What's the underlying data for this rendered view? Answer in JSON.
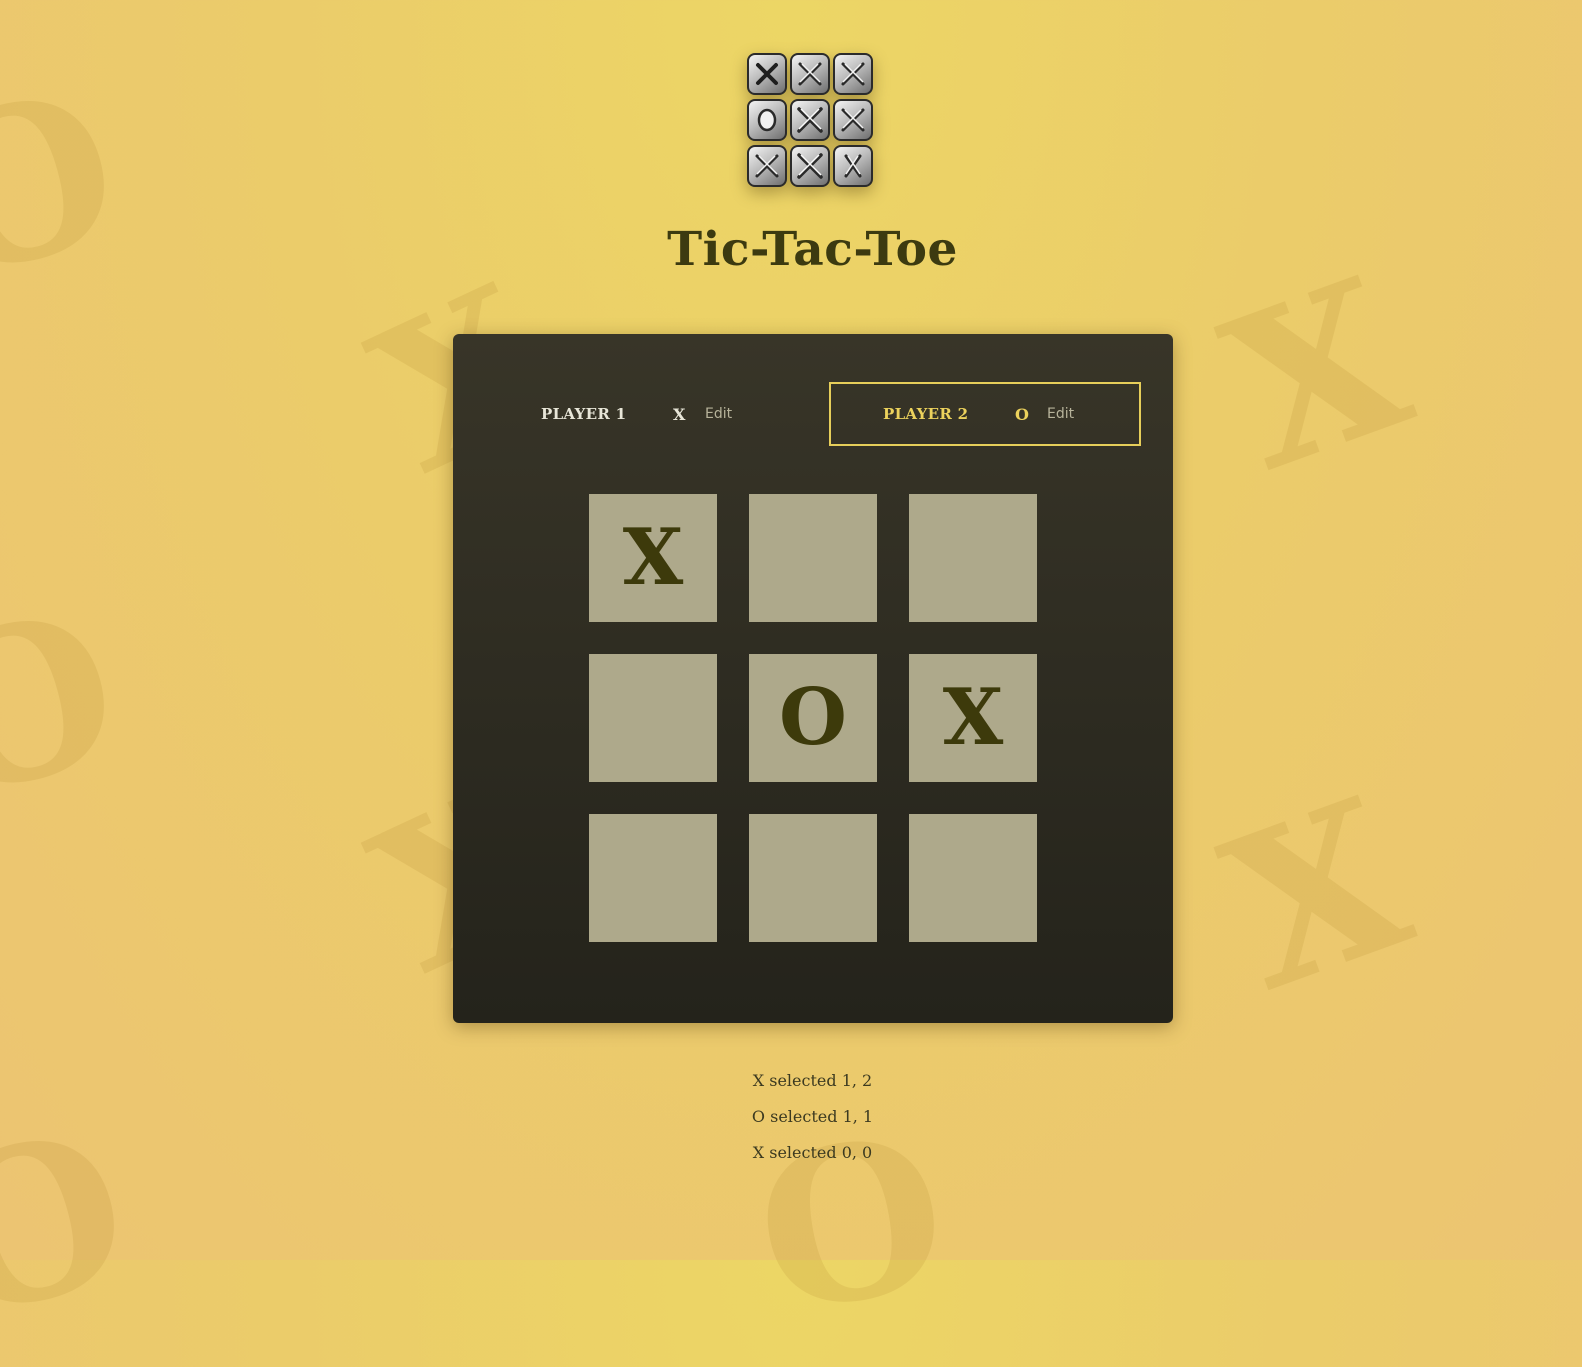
{
  "app": {
    "title": "Tic-Tac-Toe",
    "logo_icon": "tic-tac-toe-logo-icon"
  },
  "background": {
    "glyph_color": "#be963c",
    "glyphs": [
      "O",
      "X",
      "X",
      "O",
      "X",
      "X",
      "O",
      "O"
    ]
  },
  "players": [
    {
      "label": "PLAYER 1",
      "symbol": "X",
      "edit_label": "Edit",
      "active": false
    },
    {
      "label": "PLAYER 2",
      "symbol": "O",
      "edit_label": "Edit",
      "active": true
    }
  ],
  "board": {
    "cells": [
      [
        "X",
        "",
        ""
      ],
      [
        "",
        "O",
        "X"
      ],
      [
        "",
        "",
        ""
      ]
    ]
  },
  "log": [
    "X selected 1, 2",
    "O selected 1, 1",
    "X selected 0, 0"
  ],
  "colors": {
    "accent": "#e6ce5a",
    "cell_bg": "#aea98b",
    "mark": "#3d3a0b",
    "panel_top": "#383528",
    "panel_bottom": "#24231b"
  }
}
